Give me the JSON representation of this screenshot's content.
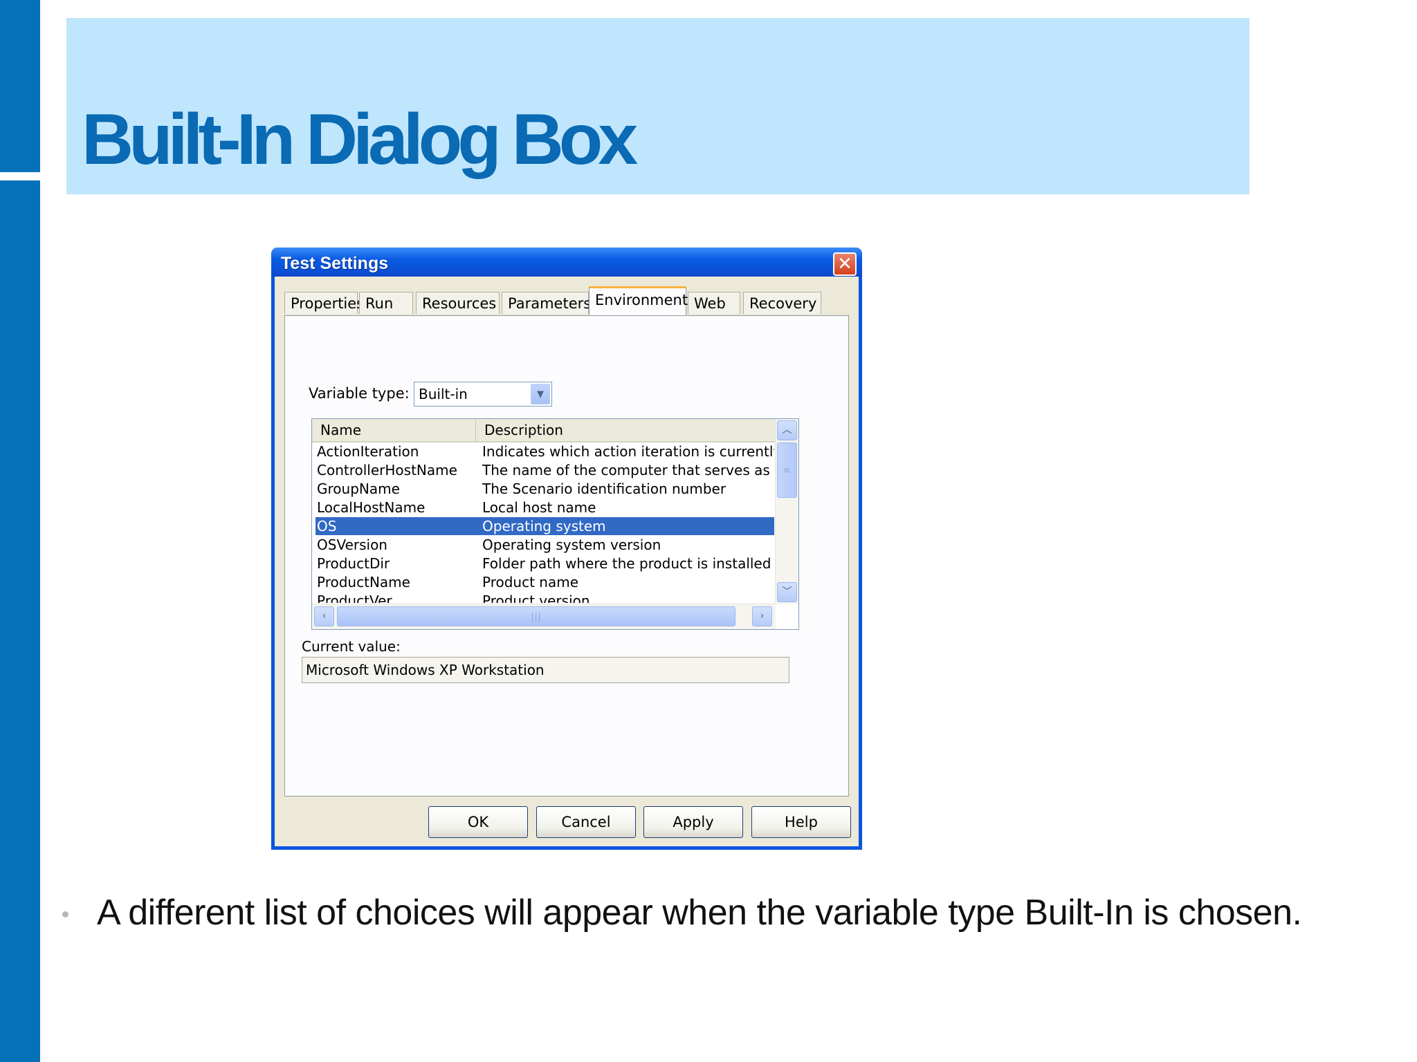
{
  "slide": {
    "title": "Built-In Dialog Box",
    "bullet": "A different list of choices will appear when the variable type Built-In is chosen."
  },
  "dialog": {
    "title": "Test Settings",
    "close_glyph": "✕",
    "tabs": [
      {
        "label": "Properties",
        "active": false
      },
      {
        "label": "Run",
        "active": false
      },
      {
        "label": "Resources",
        "active": false
      },
      {
        "label": "Parameters",
        "active": false
      },
      {
        "label": "Environment",
        "active": true
      },
      {
        "label": "Web",
        "active": false
      },
      {
        "label": "Recovery",
        "active": false
      }
    ],
    "variable_type_label": "Variable type:",
    "variable_type_value": "Built-in",
    "list": {
      "columns": [
        "Name",
        "Description"
      ],
      "rows": [
        {
          "name": "ActionIteration",
          "description": "Indicates which action iteration is currently run."
        },
        {
          "name": "ControllerHostName",
          "description": "The name of the computer that serves as the ."
        },
        {
          "name": "GroupName",
          "description": "The Scenario identification number"
        },
        {
          "name": "LocalHostName",
          "description": "Local host name"
        },
        {
          "name": "OS",
          "description": "Operating system",
          "selected": true
        },
        {
          "name": "OSVersion",
          "description": "Operating system version"
        },
        {
          "name": "ProductDir",
          "description": "Folder path where the product is installed"
        },
        {
          "name": "ProductName",
          "description": "Product name"
        },
        {
          "name": "ProductVer",
          "description": "Product version"
        }
      ]
    },
    "current_value_label": "Current value:",
    "current_value": "Microsoft Windows XP Workstation",
    "buttons": {
      "ok": "OK",
      "cancel": "Cancel",
      "apply": "Apply",
      "help": "Help"
    }
  },
  "colors": {
    "accent_bar": "#0571b8",
    "title_band": "#bfe6fd",
    "title_text": "#0a6ab3",
    "xp_titlebar": "#0a55e0",
    "selection": "#316ac5"
  }
}
